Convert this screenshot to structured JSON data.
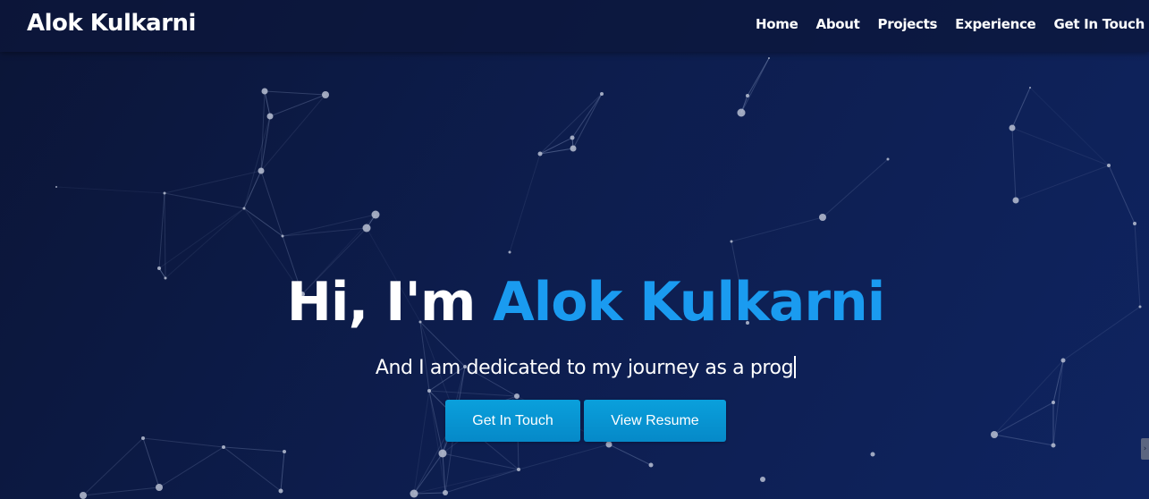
{
  "navbar": {
    "brand": "Alok Kulkarni",
    "links": [
      {
        "label": "Home"
      },
      {
        "label": "About"
      },
      {
        "label": "Projects"
      },
      {
        "label": "Experience"
      },
      {
        "label": "Get In Touch"
      }
    ]
  },
  "hero": {
    "greeting": "Hi, I'm ",
    "name": "Alok Kulkarni",
    "typed_text": "And I am dedicated to my journey as a prog",
    "buttons": {
      "contact_label": "Get In Touch",
      "resume_label": "View Resume"
    }
  },
  "colors": {
    "accent": "#1a9bf0",
    "button": "#0895d2",
    "background": "#0d1d4d"
  },
  "icons": {
    "scroll_handle": "chevron-right-icon"
  }
}
